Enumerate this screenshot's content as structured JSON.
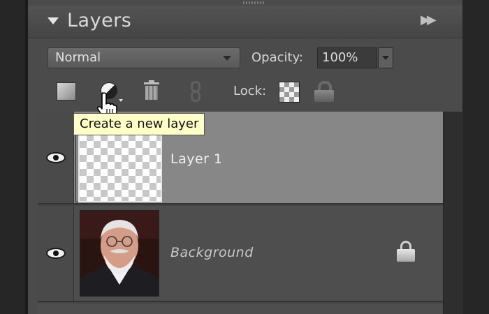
{
  "panel": {
    "title": "Layers",
    "collapse_icon": "triangle-down-icon",
    "menu_icon": "double-chevron-right-icon"
  },
  "controls": {
    "blend_mode": "Normal",
    "opacity_label": "Opacity:",
    "opacity_value": "100%",
    "lock_label": "Lock:"
  },
  "toolbar": {
    "icons": [
      "new-layer-icon",
      "adjustment-layer-icon",
      "trash-icon",
      "link-icon",
      "lock-transparent-icon",
      "lock-all-icon"
    ]
  },
  "tooltip": {
    "text": "Create a new layer"
  },
  "layers": [
    {
      "name": "Layer 1",
      "visible": true,
      "selected": true,
      "thumbnail": "transparent-checkerboard"
    },
    {
      "name": "Background",
      "visible": true,
      "selected": false,
      "locked": true,
      "thumbnail": "portrait-photo"
    }
  ],
  "colors": {
    "panel_bg": "#4b4b4b",
    "selected_row": "#878787",
    "tooltip_bg": "#ffffc8"
  }
}
